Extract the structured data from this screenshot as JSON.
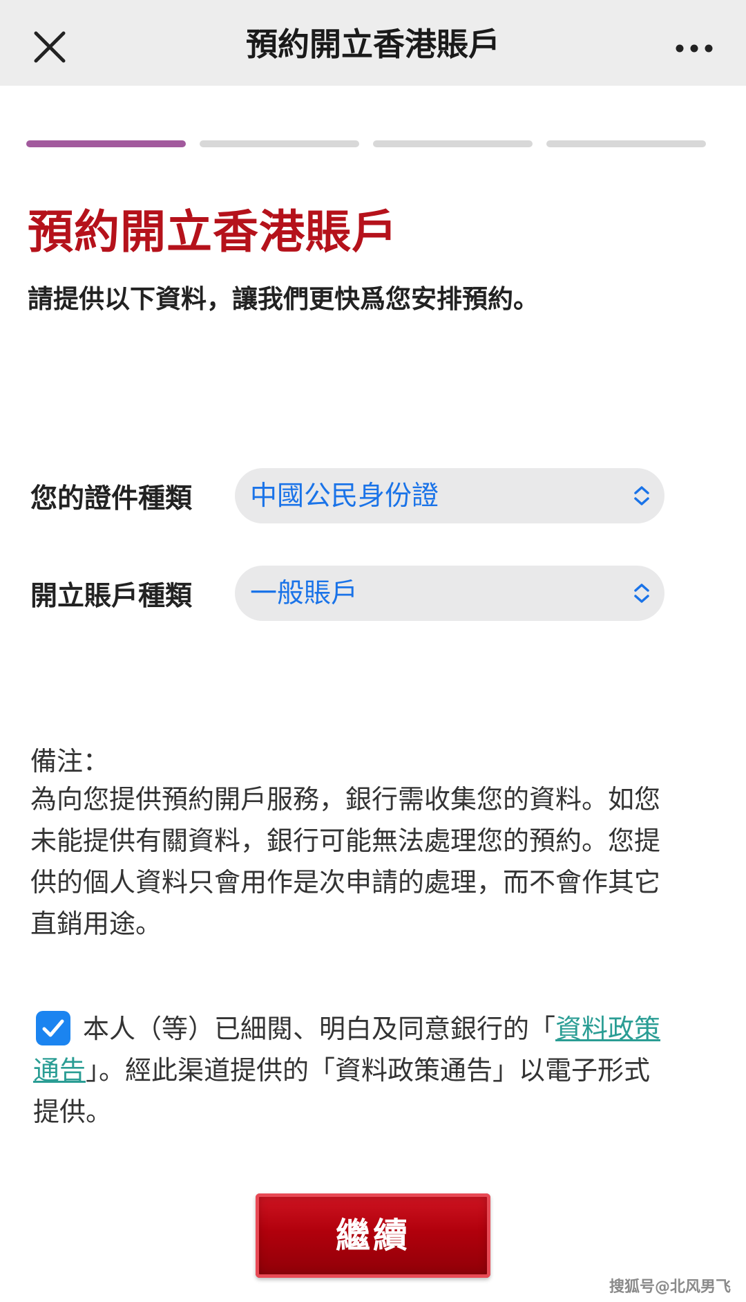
{
  "header": {
    "title": "預約開立香港賬戶"
  },
  "progress": {
    "total_steps": 4,
    "current_step": 1,
    "active_color": "#a25a9d",
    "inactive_color": "#d8d8d8"
  },
  "main": {
    "title": "預約開立香港賬戶",
    "subtitle": "請提供以下資料，讓我們更快爲您安排預約。",
    "title_color": "#b5121b"
  },
  "form": {
    "id_type": {
      "label": "您的證件種類",
      "value": "中國公民身份證"
    },
    "account_type": {
      "label": "開立賬戶種類",
      "value": "一般賬戶"
    }
  },
  "note": {
    "title": "備注：",
    "lines": [
      "為向您提供預約開戶服務，銀行需收集您的資料。如您",
      "未能提供有關資料，銀行可能無法處理您的預約。您提",
      "供的個人資料只會用作是次申請的處理，而不會作其它",
      "直銷用途。"
    ]
  },
  "consent": {
    "checked": true,
    "text_before": "本人（等）已細閱、明白及同意銀行的「",
    "link_part1": "資料政策",
    "link_part2": "通告",
    "text_after": "」。經此渠道提供的「資料政策通告」以電子形式",
    "text_end": "提供。",
    "link_color": "#2a9d94"
  },
  "actions": {
    "continue_label": "繼續",
    "button_color": "#b1000c"
  },
  "watermark": {
    "text": "搜狐号@北风男飞"
  },
  "icons": {
    "close": "close-icon",
    "more": "more-icon",
    "select_chevron": "chevron-up-down-icon",
    "checkmark": "checkmark-icon"
  }
}
